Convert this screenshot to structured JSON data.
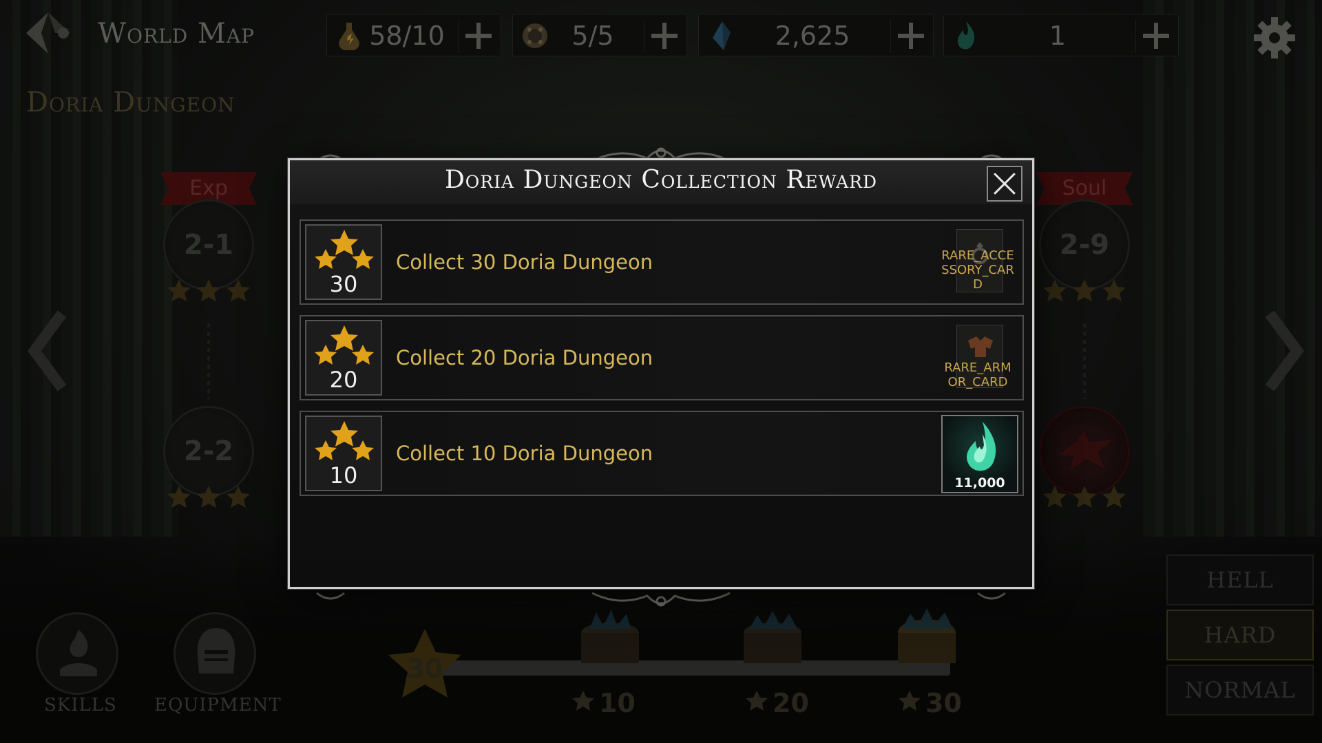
{
  "header": {
    "title": "World Map",
    "settings_icon": "gear-icon",
    "resources": [
      {
        "icon": "stamina-potion-icon",
        "value": "58/10"
      },
      {
        "icon": "dungeon-ticket-icon",
        "value": "5/5"
      },
      {
        "icon": "crystal-gem-icon",
        "value": "2,625"
      },
      {
        "icon": "soul-flame-icon",
        "value": "1"
      }
    ]
  },
  "dungeon": {
    "title": "Doria Dungeon",
    "stages": [
      {
        "label": "2-1",
        "ribbon": "Exp",
        "stars": 3
      },
      {
        "label": "2-2",
        "ribbon": "",
        "stars": 3
      },
      {
        "label": "2-9",
        "ribbon": "Soul",
        "stars": 3
      },
      {
        "label": "",
        "ribbon": "",
        "stars": 3,
        "boss": true
      }
    ]
  },
  "bottom": {
    "skills_label": "SKILLS",
    "equipment_label": "EQUIPMENT",
    "total_stars": "30",
    "progress_fraction": 1.0,
    "milestones": [
      "10",
      "20",
      "30"
    ]
  },
  "difficulty": {
    "options": [
      "HELL",
      "HARD",
      "NORMAL"
    ],
    "selected": "HARD"
  },
  "modal": {
    "title": "Doria Dungeon Collection Reward",
    "rewards": [
      {
        "stars": "30",
        "text": "Collect 30 Doria Dungeon",
        "item_type": "card",
        "item_label": "RARE_ACCESSORY_CARD"
      },
      {
        "stars": "20",
        "text": "Collect 20 Doria Dungeon",
        "item_type": "card",
        "item_label": "RARE_ARMOR_CARD"
      },
      {
        "stars": "10",
        "text": "Collect 10 Doria Dungeon",
        "item_type": "soul",
        "item_label": "11,000"
      }
    ]
  },
  "colors": {
    "accent_gold": "#d6b85a",
    "star_gold": "#e0a11b",
    "soul_teal": "#3fd3a5"
  }
}
